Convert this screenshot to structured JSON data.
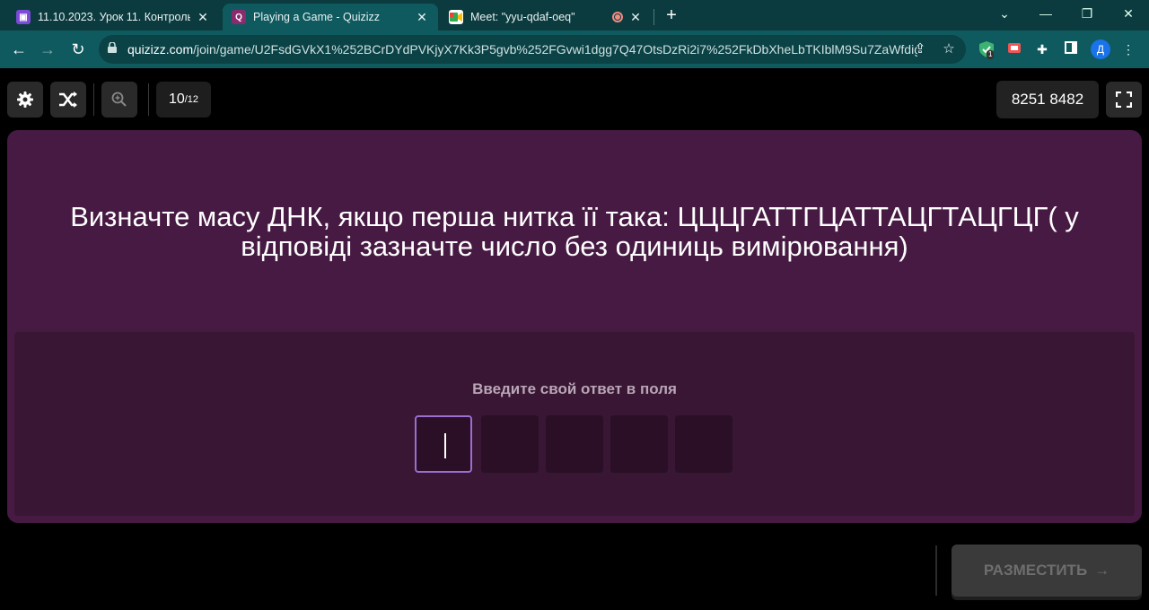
{
  "browser": {
    "tabs": [
      {
        "title": "11.10.2023. Урок 11. Контроль з",
        "icon": "classroom-icon",
        "color": "#7b4ad6"
      },
      {
        "title": "Playing a Game - Quizizz",
        "icon": "quizizz-icon",
        "color": "#8b2a6e"
      },
      {
        "title": "Meet: \"yyu-qdaf-oeq\"",
        "icon": "meet-icon",
        "color": "#1a73e8"
      }
    ],
    "url_host": "quizizz.com",
    "url_path": "/join/game/U2FsdGVkX1%252BCrDYdPVKjyX7Kk3P5gvb%252FGvwi1dgg7Q47OtsDzRi2i7%252FkDbXheLbTKIblM9Su7ZaWfdigj...",
    "profile_initial": "Д",
    "extension_badge": "1"
  },
  "game": {
    "question_number": "10",
    "question_total": "/12",
    "join_code": "8251 8482",
    "question_text": "Визначте масу ДНК, якщо перша нитка її така: ЦЦЦГАТТГЦАТТАЦГТАЦГЦГ( у відповіді зазначте число без одиниць вимірювання)",
    "answer_prompt": "Введите свой ответ в поля",
    "submit_label": "РАЗМЕСТИТЬ",
    "colors": {
      "card": "#461a42",
      "panel": "#391634",
      "focus": "#9b6ed1"
    }
  }
}
